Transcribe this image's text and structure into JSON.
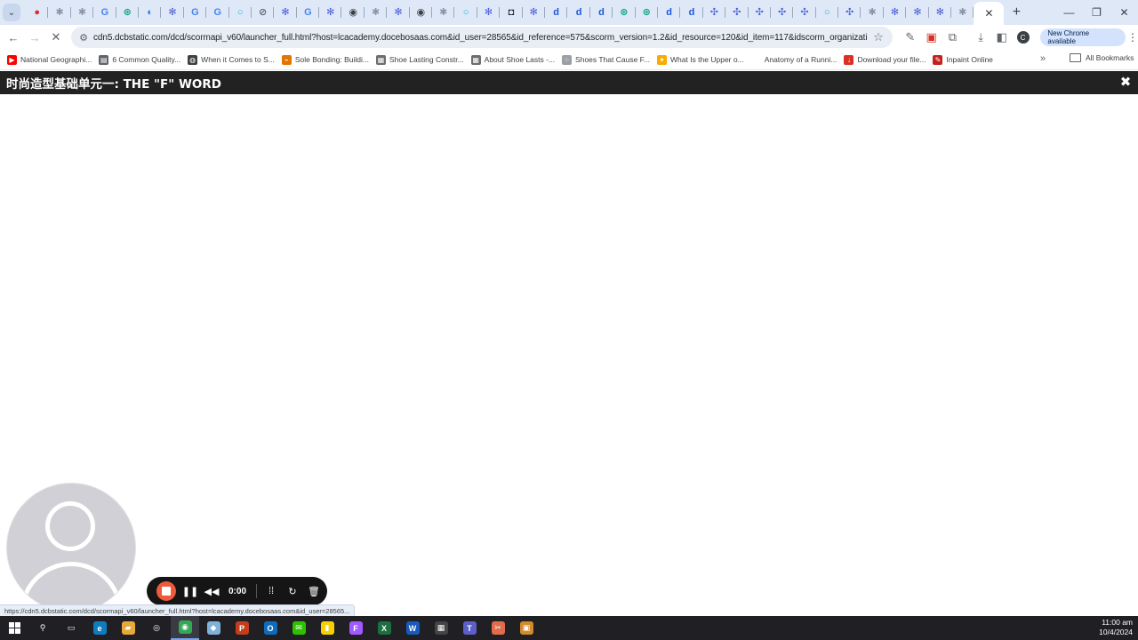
{
  "browser": {
    "tab_count": 44,
    "tabs": [
      {
        "icon": "shield-icon",
        "color": "#d93025",
        "glyph": "●"
      },
      {
        "icon": "gear-icon",
        "color": "#8a94a8",
        "glyph": "✱"
      },
      {
        "icon": "gear-icon",
        "color": "#8a94a8",
        "glyph": "✱"
      },
      {
        "icon": "google-icon",
        "color": "#4285f4",
        "glyph": "G"
      },
      {
        "icon": "chatgpt-icon",
        "color": "#10a37f",
        "glyph": "⊛"
      },
      {
        "icon": "edge-icon",
        "color": "#1a73e8",
        "glyph": "◐"
      },
      {
        "icon": "gear-icon",
        "color": "#4a5fd8",
        "glyph": "✻"
      },
      {
        "icon": "google-icon",
        "color": "#4285f4",
        "glyph": "G"
      },
      {
        "icon": "google-icon",
        "color": "#4285f4",
        "glyph": "G"
      },
      {
        "icon": "circle-icon",
        "color": "#19b6e3",
        "glyph": "○"
      },
      {
        "icon": "block-icon",
        "color": "#5f6368",
        "glyph": "⊘"
      },
      {
        "icon": "gear-icon",
        "color": "#4a5fd8",
        "glyph": "✻"
      },
      {
        "icon": "google-icon",
        "color": "#4285f4",
        "glyph": "G"
      },
      {
        "icon": "gear-icon",
        "color": "#4a5fd8",
        "glyph": "✻"
      },
      {
        "icon": "chrome-icon",
        "color": "#3c4043",
        "glyph": "◉"
      },
      {
        "icon": "gear-icon",
        "color": "#8a94a8",
        "glyph": "✱"
      },
      {
        "icon": "gear-icon",
        "color": "#4a5fd8",
        "glyph": "✻"
      },
      {
        "icon": "chrome-icon",
        "color": "#3c4043",
        "glyph": "◉"
      },
      {
        "icon": "gear-icon",
        "color": "#8a94a8",
        "glyph": "✱"
      },
      {
        "icon": "circle-icon",
        "color": "#19b6e3",
        "glyph": "○"
      },
      {
        "icon": "gear-icon",
        "color": "#4a5fd8",
        "glyph": "✻"
      },
      {
        "icon": "lens-icon",
        "color": "#202124",
        "glyph": "◘"
      },
      {
        "icon": "gear-icon",
        "color": "#4a5fd8",
        "glyph": "✻"
      },
      {
        "icon": "docebo-icon",
        "color": "#1a56db",
        "glyph": "d"
      },
      {
        "icon": "docebo-icon",
        "color": "#1a56db",
        "glyph": "d"
      },
      {
        "icon": "docebo-icon",
        "color": "#1a56db",
        "glyph": "d"
      },
      {
        "icon": "chatgpt-icon",
        "color": "#10a37f",
        "glyph": "⊛"
      },
      {
        "icon": "chatgpt-icon",
        "color": "#10a37f",
        "glyph": "⊛"
      },
      {
        "icon": "docebo-icon",
        "color": "#1a56db",
        "glyph": "d"
      },
      {
        "icon": "docebo-icon",
        "color": "#1a56db",
        "glyph": "d"
      },
      {
        "icon": "sparkle-icon",
        "color": "#4a5fd8",
        "glyph": "✣"
      },
      {
        "icon": "sparkle-icon",
        "color": "#4a5fd8",
        "glyph": "✣"
      },
      {
        "icon": "sparkle-icon",
        "color": "#4a5fd8",
        "glyph": "✣"
      },
      {
        "icon": "sparkle-icon",
        "color": "#4a5fd8",
        "glyph": "✣"
      },
      {
        "icon": "sparkle-icon",
        "color": "#4a5fd8",
        "glyph": "✣"
      },
      {
        "icon": "circle-icon",
        "color": "#19b6e3",
        "glyph": "○"
      },
      {
        "icon": "sparkle-icon",
        "color": "#4a5fd8",
        "glyph": "✣"
      },
      {
        "icon": "gear-icon",
        "color": "#8a94a8",
        "glyph": "✱"
      },
      {
        "icon": "gear-icon",
        "color": "#4a5fd8",
        "glyph": "✻"
      },
      {
        "icon": "gear-icon",
        "color": "#4a5fd8",
        "glyph": "✻"
      },
      {
        "icon": "gear-icon",
        "color": "#4a5fd8",
        "glyph": "✻"
      },
      {
        "icon": "gear-icon",
        "color": "#8a94a8",
        "glyph": "✱"
      }
    ],
    "active_tab_close": "✕",
    "new_tab": "+",
    "window_controls": {
      "minimize": "—",
      "restore": "❐",
      "close": "✕"
    },
    "url": "cdn5.dcbstatic.com/dcd/scormapi_v60/launcher_full.html?host=lcacademy.docebosaas.com&id_user=28565&id_reference=575&scorm_version=1.2&id_resource=120&id_item=117&idscorm_organization=117&...",
    "update_label": "New Chrome available",
    "profile_initial": "C"
  },
  "bookmarks": [
    {
      "label": "National Geographi...",
      "icon": "youtube-icon",
      "color": "#ff0000",
      "glyph": "▶"
    },
    {
      "label": "6 Common Quality...",
      "icon": "page-icon",
      "color": "#5f6368",
      "glyph": "▤"
    },
    {
      "label": "When it Comes to S...",
      "icon": "globe-icon",
      "color": "#3c4043",
      "glyph": "◍"
    },
    {
      "label": "Sole Bonding: Buildi...",
      "icon": "shoe-icon",
      "color": "#e37400",
      "glyph": "⌁"
    },
    {
      "label": "Shoe Lasting Constr...",
      "icon": "image-icon",
      "color": "#6d6d6d",
      "glyph": "▦"
    },
    {
      "label": "About Shoe Lasts -...",
      "icon": "image-icon",
      "color": "#6d6d6d",
      "glyph": "▦"
    },
    {
      "label": "Shoes That Cause F...",
      "icon": "dots-icon",
      "color": "#9aa0a6",
      "glyph": "⁘"
    },
    {
      "label": "What Is the Upper o...",
      "icon": "sparkle-icon",
      "color": "#f9ab00",
      "glyph": "✦"
    },
    {
      "label": "Anatomy of a Runni...",
      "icon": "blank-icon",
      "color": "#ffffff",
      "glyph": ""
    },
    {
      "label": "Download your file...",
      "icon": "download-icon",
      "color": "#d93025",
      "glyph": "↓"
    },
    {
      "label": "Inpaint Online",
      "icon": "brush-icon",
      "color": "#c5221f",
      "glyph": "✎"
    }
  ],
  "bookmarks_more": "»",
  "all_bookmarks": "All Bookmarks",
  "course": {
    "title": "时尚造型基础单元一: THE \"F\" WORD",
    "close_glyph": "✖"
  },
  "recorder": {
    "time": "0:00"
  },
  "status_url": "https://cdn5.dcbstatic.com/dcd/scormapi_v60/launcher_full.html?host=lcacademy.docebosaas.com&id_user=28565...",
  "taskbar": {
    "apps": [
      {
        "name": "search-icon",
        "color": "#1f1f24",
        "glyph": "⚲"
      },
      {
        "name": "task-view-icon",
        "color": "#1f1f24",
        "glyph": "▭"
      },
      {
        "name": "edge-icon",
        "color": "#0f7cbf",
        "glyph": "e"
      },
      {
        "name": "file-explorer-icon",
        "color": "#e8a93b",
        "glyph": "▰"
      },
      {
        "name": "cortana-icon",
        "color": "#1f1f24",
        "glyph": "◎"
      },
      {
        "name": "chrome-icon",
        "color": "#34a853",
        "glyph": "◉"
      },
      {
        "name": "notes-icon",
        "color": "#7fb2d8",
        "glyph": "◆"
      },
      {
        "name": "powerpoint-icon",
        "color": "#c43e1c",
        "glyph": "P"
      },
      {
        "name": "outlook-icon",
        "color": "#0f6cbd",
        "glyph": "O"
      },
      {
        "name": "wechat-icon",
        "color": "#2dc100",
        "glyph": "✉"
      },
      {
        "name": "sticky-notes-icon",
        "color": "#f7d000",
        "glyph": "▮"
      },
      {
        "name": "figma-icon",
        "color": "#a259ff",
        "glyph": "F"
      },
      {
        "name": "excel-icon",
        "color": "#1d6f42",
        "glyph": "X"
      },
      {
        "name": "word-icon",
        "color": "#185abd",
        "glyph": "W"
      },
      {
        "name": "calculator-icon",
        "color": "#444444",
        "glyph": "▦"
      },
      {
        "name": "teams-icon",
        "color": "#5b5fc7",
        "glyph": "T"
      },
      {
        "name": "snipping-icon",
        "color": "#e06c4b",
        "glyph": "✂"
      },
      {
        "name": "package-icon",
        "color": "#d08b2c",
        "glyph": "▣"
      }
    ],
    "time": "11:00 am",
    "date": "10/4/2024"
  }
}
